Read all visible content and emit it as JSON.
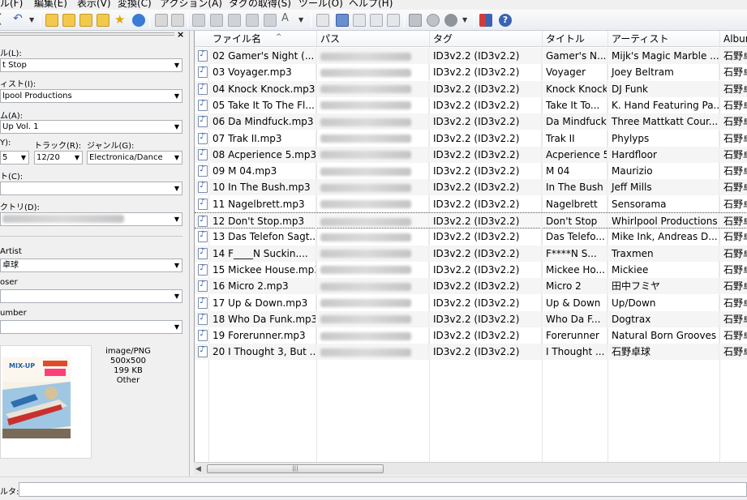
{
  "menubar": {
    "items": [
      "ル(F)",
      "編集(E)",
      "表示(V)",
      "変換(C)",
      "アクション(A)",
      "タグの取得(S)",
      "ツール(O)",
      "ヘルプ(H)"
    ]
  },
  "toolbar": {
    "icons": [
      "undo-icon",
      "open-folder-icon",
      "add-folder-icon",
      "favorites-folder-icon",
      "playlist-folder-icon",
      "star-icon",
      "refresh-icon",
      "save-icon",
      "remove-tag-icon",
      "tag-source-icon",
      "tag-from-filename-icon",
      "filename-from-tag-icon",
      "rename-icon",
      "case-conversion-icon",
      "text-file-icon",
      "export-icon",
      "playlist-icon",
      "info-icon",
      "folder-icon",
      "web-source-icon",
      "web-source-2-icon",
      "tools-icon",
      "help-icon"
    ]
  },
  "left_panel": {
    "title_label": "ル(L):",
    "title_value": "t Stop",
    "artist_label": "ィスト(I):",
    "artist_value": "lpool Productions",
    "album_label": "ム(A):",
    "album_value": "Up Vol. 1",
    "year_label": "Y):",
    "year_value": "5",
    "track_label": "トラック(R):",
    "track_value": "12/20",
    "genre_label": "ジャンル(G):",
    "genre_value": "Electronica/Dance",
    "comment_label": "ト(C):",
    "comment_value": "",
    "directory_label": "クトリ(D):",
    "album_artist_label": "Artist",
    "album_artist_value": "卓球",
    "composer_label": "oser",
    "composer_value": "",
    "discnumber_label": "umber",
    "discnumber_value": "",
    "cover": {
      "format": "image/PNG",
      "dimensions": "500x500",
      "size": "199 KB",
      "type": "Other",
      "art_title": "MIX-UP"
    }
  },
  "table": {
    "columns": [
      "ファイル名",
      "パス",
      "タグ",
      "タイトル",
      "アーティスト",
      "Album"
    ],
    "rows": [
      {
        "filename": "02 Gamer's Night (...",
        "tag": "ID3v2.2 (ID3v2.2)",
        "title": "Gamer's N...",
        "artist": "Mijk's Magic Marble ...",
        "album": "石野卓球"
      },
      {
        "filename": "03 Voyager.mp3",
        "tag": "ID3v2.2 (ID3v2.2)",
        "title": "Voyager",
        "artist": "Joey Beltram",
        "album": "石野卓球"
      },
      {
        "filename": "04 Knock Knock.mp3",
        "tag": "ID3v2.2 (ID3v2.2)",
        "title": "Knock Knock",
        "artist": "DJ Funk",
        "album": "石野卓球"
      },
      {
        "filename": "05 Take It To The Fl...",
        "tag": "ID3v2.2 (ID3v2.2)",
        "title": "Take It To...",
        "artist": "K. Hand Featuring Pa...",
        "album": "石野卓球"
      },
      {
        "filename": "06 Da Mindfuck.mp3",
        "tag": "ID3v2.2 (ID3v2.2)",
        "title": "Da Mindfuck",
        "artist": "Three Mattkatt Cour...",
        "album": "石野卓球"
      },
      {
        "filename": "07 Trak II.mp3",
        "tag": "ID3v2.2 (ID3v2.2)",
        "title": "Trak II",
        "artist": "Phylyps",
        "album": "石野卓球"
      },
      {
        "filename": "08 Acperience 5.mp3",
        "tag": "ID3v2.2 (ID3v2.2)",
        "title": "Acperience 5",
        "artist": "Hardfloor",
        "album": "石野卓球"
      },
      {
        "filename": "09 M 04.mp3",
        "tag": "ID3v2.2 (ID3v2.2)",
        "title": "M 04",
        "artist": "Maurizio",
        "album": "石野卓球"
      },
      {
        "filename": "10 In The Bush.mp3",
        "tag": "ID3v2.2 (ID3v2.2)",
        "title": "In The Bush",
        "artist": "Jeff Mills",
        "album": "石野卓球"
      },
      {
        "filename": "11 Nagelbrett.mp3",
        "tag": "ID3v2.2 (ID3v2.2)",
        "title": "Nagelbrett",
        "artist": "Sensorama",
        "album": "石野卓球"
      },
      {
        "filename": "12 Don't Stop.mp3",
        "tag": "ID3v2.2 (ID3v2.2)",
        "title": "Don't Stop",
        "artist": "Whirlpool Productions",
        "album": "石野卓球",
        "selected": true
      },
      {
        "filename": "13 Das Telefon Sagt...",
        "tag": "ID3v2.2 (ID3v2.2)",
        "title": "Das Telefo...",
        "artist": "Mike Ink, Andreas D...",
        "album": "石野卓球"
      },
      {
        "filename": "14 F____N Suckin....",
        "tag": "ID3v2.2 (ID3v2.2)",
        "title": "F****N S...",
        "artist": "Traxmen",
        "album": "石野卓球"
      },
      {
        "filename": "15 Mickee House.mp3",
        "tag": "ID3v2.2 (ID3v2.2)",
        "title": "Mickee Ho...",
        "artist": "Mickiee",
        "album": "石野卓球"
      },
      {
        "filename": "16 Micro 2.mp3",
        "tag": "ID3v2.2 (ID3v2.2)",
        "title": "Micro 2",
        "artist": "田中フミヤ",
        "album": "石野卓球"
      },
      {
        "filename": "17 Up & Down.mp3",
        "tag": "ID3v2.2 (ID3v2.2)",
        "title": "Up & Down",
        "artist": "Up/Down",
        "album": "石野卓球"
      },
      {
        "filename": "18 Who Da Funk.mp3",
        "tag": "ID3v2.2 (ID3v2.2)",
        "title": "Who Da F...",
        "artist": "Dogtrax",
        "album": "石野卓球"
      },
      {
        "filename": "19 Forerunner.mp3",
        "tag": "ID3v2.2 (ID3v2.2)",
        "title": "Forerunner",
        "artist": "Natural Born Grooves",
        "album": "石野卓球"
      },
      {
        "filename": "20 I Thought 3, But ...",
        "tag": "ID3v2.2 (ID3v2.2)",
        "title": "I Thought ...",
        "artist": "石野卓球",
        "album": "石野卓球"
      }
    ]
  },
  "filter": {
    "label": "ルタ:",
    "value": ""
  },
  "colors": {
    "selected_row_bg": "#f7f7f7",
    "alt_row_bg": "#f5f5f5",
    "file_icon": "#2a5bb0"
  }
}
